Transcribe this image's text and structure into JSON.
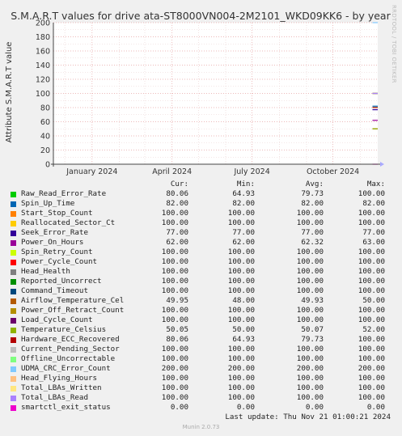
{
  "title": "S.M.A.R.T values for drive ata-ST8000VN004-2M2101_WKD09KK6 - by year",
  "side_text": "RRDTOOL / TOBI OETIKER",
  "legend_headers": {
    "cur": "Cur:",
    "min": "Min:",
    "avg": "Avg:",
    "max": "Max:"
  },
  "last_update": "Last update: Thu Nov 21 01:00:21 2024",
  "munin_version": "Munin 2.0.73",
  "chart_data": {
    "type": "line",
    "title": "S.M.A.R.T values for drive ata-ST8000VN004-2M2101_WKD09KK6 - by year",
    "ylabel": "Attribute S.M.A.R.T value",
    "xlabel": "",
    "ylim": [
      0,
      200
    ],
    "yticks": [
      0,
      20,
      40,
      60,
      80,
      100,
      120,
      140,
      160,
      180,
      200
    ],
    "xticks": [
      "January 2024",
      "April 2024",
      "July 2024",
      "October 2024"
    ],
    "x_range": [
      "2023-11-18",
      "2024-11-21"
    ],
    "x_tick_dates": [
      "2024-01-01",
      "2024-04-01",
      "2024-07-01",
      "2024-10-01"
    ],
    "data_start": "2024-11-15",
    "grid": true,
    "series": [
      {
        "name": "Raw_Read_Error_Rate",
        "color": "#00cc00",
        "cur": "80.06",
        "min": "64.93",
        "avg": "79.73",
        "max": "100.00"
      },
      {
        "name": "Spin_Up_Time",
        "color": "#0066b3",
        "cur": "82.00",
        "min": "82.00",
        "avg": "82.00",
        "max": "82.00"
      },
      {
        "name": "Start_Stop_Count",
        "color": "#ff8000",
        "cur": "100.00",
        "min": "100.00",
        "avg": "100.00",
        "max": "100.00"
      },
      {
        "name": "Reallocated_Sector_Ct",
        "color": "#ffcc00",
        "cur": "100.00",
        "min": "100.00",
        "avg": "100.00",
        "max": "100.00"
      },
      {
        "name": "Seek_Error_Rate",
        "color": "#330099",
        "cur": "77.00",
        "min": "77.00",
        "avg": "77.00",
        "max": "77.00"
      },
      {
        "name": "Power_On_Hours",
        "color": "#990099",
        "cur": "62.00",
        "min": "62.00",
        "avg": "62.32",
        "max": "63.00"
      },
      {
        "name": "Spin_Retry_Count",
        "color": "#ccff00",
        "cur": "100.00",
        "min": "100.00",
        "avg": "100.00",
        "max": "100.00"
      },
      {
        "name": "Power_Cycle_Count",
        "color": "#ff0000",
        "cur": "100.00",
        "min": "100.00",
        "avg": "100.00",
        "max": "100.00"
      },
      {
        "name": "Head_Health",
        "color": "#808080",
        "cur": "100.00",
        "min": "100.00",
        "avg": "100.00",
        "max": "100.00"
      },
      {
        "name": "Reported_Uncorrect",
        "color": "#008f00",
        "cur": "100.00",
        "min": "100.00",
        "avg": "100.00",
        "max": "100.00"
      },
      {
        "name": "Command_Timeout",
        "color": "#00487d",
        "cur": "100.00",
        "min": "100.00",
        "avg": "100.00",
        "max": "100.00"
      },
      {
        "name": "Airflow_Temperature_Cel",
        "color": "#b35a00",
        "cur": "49.95",
        "min": "48.00",
        "avg": "49.93",
        "max": "50.00"
      },
      {
        "name": "Power_Off_Retract_Count",
        "color": "#b38f00",
        "cur": "100.00",
        "min": "100.00",
        "avg": "100.00",
        "max": "100.00"
      },
      {
        "name": "Load_Cycle_Count",
        "color": "#6b006b",
        "cur": "100.00",
        "min": "100.00",
        "avg": "100.00",
        "max": "100.00"
      },
      {
        "name": "Temperature_Celsius",
        "color": "#8fb300",
        "cur": "50.05",
        "min": "50.00",
        "avg": "50.07",
        "max": "52.00"
      },
      {
        "name": "Hardware_ECC_Recovered",
        "color": "#b30000",
        "cur": "80.06",
        "min": "64.93",
        "avg": "79.73",
        "max": "100.00"
      },
      {
        "name": "Current_Pending_Sector",
        "color": "#bebebe",
        "cur": "100.00",
        "min": "100.00",
        "avg": "100.00",
        "max": "100.00"
      },
      {
        "name": "Offline_Uncorrectable",
        "color": "#80ff80",
        "cur": "100.00",
        "min": "100.00",
        "avg": "100.00",
        "max": "100.00"
      },
      {
        "name": "UDMA_CRC_Error_Count",
        "color": "#80c9ff",
        "cur": "200.00",
        "min": "200.00",
        "avg": "200.00",
        "max": "200.00"
      },
      {
        "name": "Head_Flying_Hours",
        "color": "#ffc080",
        "cur": "100.00",
        "min": "100.00",
        "avg": "100.00",
        "max": "100.00"
      },
      {
        "name": "Total_LBAs_Written",
        "color": "#ffe680",
        "cur": "100.00",
        "min": "100.00",
        "avg": "100.00",
        "max": "100.00"
      },
      {
        "name": "Total_LBAs_Read",
        "color": "#aa80ff",
        "cur": "100.00",
        "min": "100.00",
        "avg": "100.00",
        "max": "100.00"
      },
      {
        "name": "smartctl_exit_status",
        "color": "#ee00cc",
        "cur": "0.00",
        "min": "0.00",
        "avg": "0.00",
        "max": "0.00"
      }
    ]
  }
}
